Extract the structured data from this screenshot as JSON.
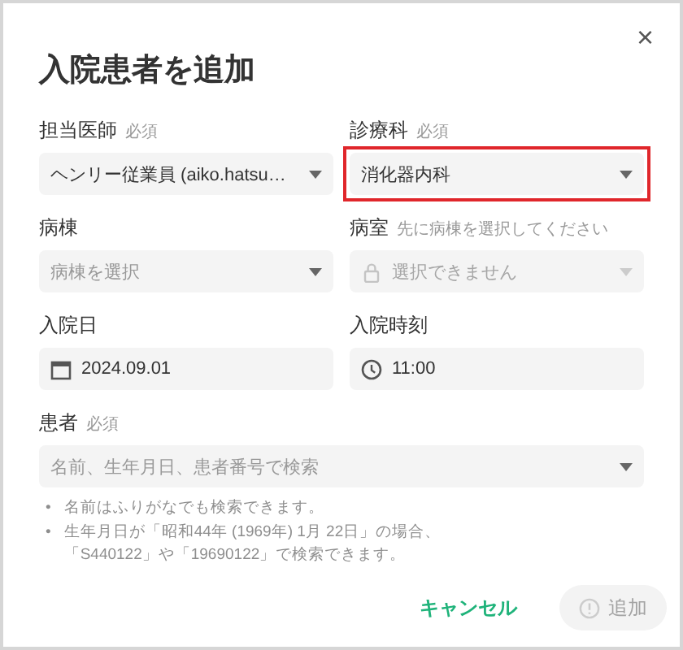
{
  "dialog": {
    "title": "入院患者を追加",
    "close": "×"
  },
  "rows": [
    [
      {
        "label": "担当医師",
        "required": "必須",
        "kind": "select",
        "value": "ヘンリー従業員 (aiko.hatsu…",
        "disabled": false,
        "highlighted": false
      },
      {
        "label": "診療科",
        "required": "必須",
        "kind": "select",
        "value": "消化器内科",
        "disabled": false,
        "highlighted": true
      }
    ],
    [
      {
        "label": "病棟",
        "kind": "select",
        "placeholder": "病棟を選択",
        "disabled": false,
        "highlighted": false
      },
      {
        "label": "病室",
        "hint": "先に病棟を選択してください",
        "kind": "select",
        "placeholder": "選択できません",
        "disabled": true,
        "highlighted": false
      }
    ],
    [
      {
        "label": "入院日",
        "kind": "date",
        "value": "2024.09.01",
        "disabled": false,
        "highlighted": false
      },
      {
        "label": "入院時刻",
        "kind": "time",
        "value": "11:00",
        "disabled": false,
        "highlighted": false
      }
    ],
    [
      {
        "label": "患者",
        "required": "必須",
        "kind": "select",
        "placeholder": "名前、生年月日、患者番号で検索",
        "disabled": false,
        "highlighted": false,
        "notes": [
          {
            "bullet": "•",
            "lines": [
              "名前はふりがなでも検索できます。"
            ]
          },
          {
            "bullet": "•",
            "lines": [
              "生年月日が「昭和44年 (1969年) 1月 22日」の場合、",
              "「S440122」や「19690122」で検索できます。"
            ]
          }
        ]
      }
    ]
  ],
  "buttons": [
    {
      "label": "キャンセル",
      "kind": "text",
      "disabled": false
    },
    {
      "label": "追加",
      "kind": "primary",
      "disabled": true
    }
  ]
}
